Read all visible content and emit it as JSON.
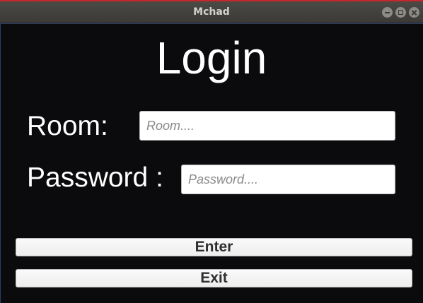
{
  "window": {
    "title": "Mchad",
    "controls": [
      "minimize-icon",
      "maximize-icon",
      "close-icon"
    ],
    "accent_color": "#c8262d"
  },
  "login": {
    "heading": "Login",
    "room_label": "Room:",
    "room_placeholder": "Room....",
    "room_value": "",
    "password_label": "Password :",
    "password_placeholder": "Password....",
    "password_value": "",
    "enter_label": "Enter",
    "exit_label": "Exit"
  }
}
